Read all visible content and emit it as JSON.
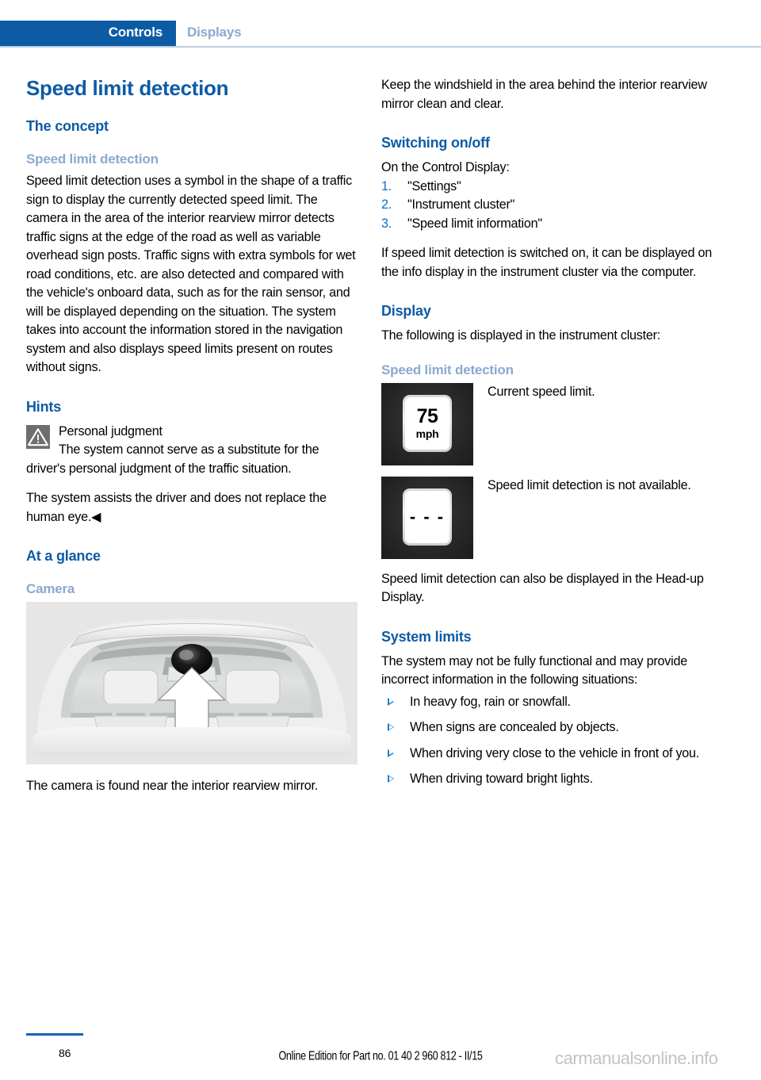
{
  "header": {
    "active_tab": "Controls",
    "inactive_tab": "Displays"
  },
  "left_column": {
    "title": "Speed limit detection",
    "section_concept": "The concept",
    "subsection_sld": "Speed limit detection",
    "concept_paragraph": "Speed limit detection uses a symbol in the shape of a traffic sign to display the currently detected speed limit. The camera in the area of the interior rearview mirror detects traffic signs at the edge of the road as well as variable overhead sign posts. Traffic signs with extra symbols for wet road conditions, etc. are also detected and compared with the vehicle's onboard data, such as for the rain sensor, and will be displayed depending on the situation. The system takes into account the information stored in the navigation system and also displays speed limits present on routes without signs.",
    "section_hints": "Hints",
    "warning_title": "Personal judgment",
    "warning_body": "The system cannot serve as a substitute for the driver's personal judgment of the traffic situation.",
    "warning_body2": "The system assists the driver and does not replace the human eye.◀",
    "section_at_a_glance": "At a glance",
    "subsection_camera": "Camera",
    "camera_caption": "The camera is found near the interior rearview mirror."
  },
  "right_column": {
    "windshield_paragraph": "Keep the windshield in the area behind the interior rearview mirror clean and clear.",
    "section_switching": "Switching on/off",
    "control_display_intro": "On the Control Display:",
    "steps": [
      {
        "number": "1.",
        "label": "\"Settings\""
      },
      {
        "number": "2.",
        "label": "\"Instrument cluster\""
      },
      {
        "number": "3.",
        "label": "\"Speed limit information\""
      }
    ],
    "switched_on_paragraph": "If speed limit detection is switched on, it can be displayed on the info display in the instrument cluster via the computer.",
    "section_display": "Display",
    "display_intro": "The following is displayed in the instrument cluster:",
    "subsection_sld": "Speed limit detection",
    "icon_rows": [
      {
        "sign_value": "75",
        "sign_unit": "mph",
        "caption": "Current speed limit."
      },
      {
        "sign_value": "- - -",
        "sign_unit": "",
        "caption": "Speed limit detection is not available."
      }
    ],
    "hud_paragraph": "Speed limit detection can also be displayed in the Head-up Display.",
    "section_system_limits": "System limits",
    "system_limits_intro": "The system may not be fully functional and may provide incorrect information in the following situations:",
    "system_limits_items": [
      "In heavy fog, rain or snowfall.",
      "When signs are concealed by objects.",
      "When driving very close to the vehicle in front of you.",
      "When driving toward bright lights."
    ]
  },
  "footer": {
    "page_number": "86",
    "edition": "Online Edition for Part no. 01 40 2 960 812 - II/15",
    "watermark": "carmanualsonline.info"
  },
  "colors": {
    "brand_blue": "#0d5ba5",
    "light_blue": "#8aa9ce",
    "accent_blue": "#1f7ec4",
    "rule_blue": "#b9cfe4"
  }
}
